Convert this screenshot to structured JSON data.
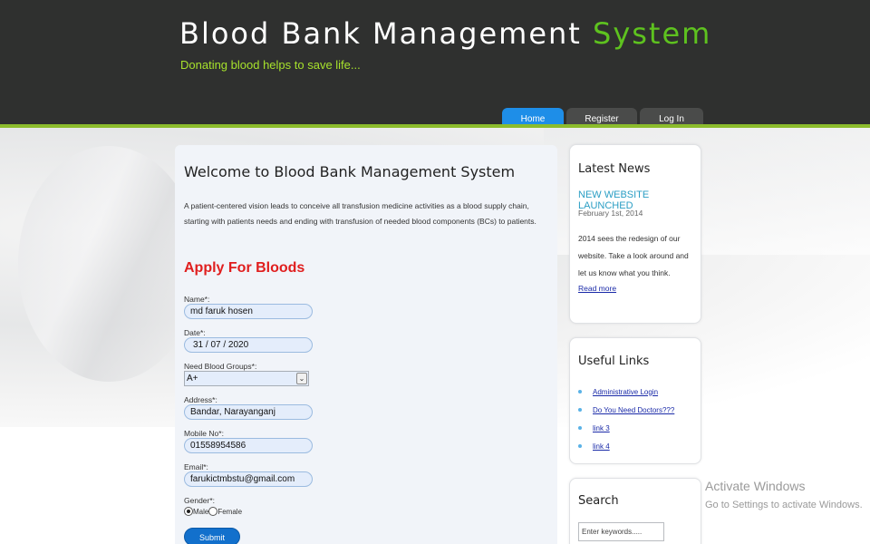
{
  "header": {
    "title_main": "Blood Bank Management ",
    "title_accent": "System",
    "tagline": "Donating blood helps to save life..."
  },
  "nav": {
    "tabs": [
      {
        "label": "Home",
        "active": true
      },
      {
        "label": "Register",
        "active": false
      },
      {
        "label": "Log In",
        "active": false
      }
    ]
  },
  "main": {
    "welcome": "Welcome to Blood Bank Management System",
    "intro": "A patient-centered vision leads to conceive all transfusion medicine activities as a blood supply chain, starting with patients needs and ending with transfusion of needed blood components (BCs) to patients.",
    "apply_title": "Apply For Bloods",
    "form": {
      "name_label": "Name*:",
      "name_value": "md faruk hosen",
      "date_label": "Date*:",
      "date_value": "31 / 07 / 2020",
      "group_label": "Need Blood Groups*:",
      "group_value": "A+",
      "address_label": "Address*:",
      "address_value": "Bandar, Narayanganj",
      "mobile_label": "Mobile No*:",
      "mobile_value": "01558954586",
      "email_label": "Email*:",
      "email_value": "farukictmbstu@gmail.com",
      "gender_label": "Gender*:",
      "gender_male": "Male",
      "gender_female": "Female",
      "gender_selected": "Male",
      "submit_label": "Submit"
    }
  },
  "sidebar": {
    "news": {
      "title": "Latest News",
      "headline": "NEW WEBSITE LAUNCHED",
      "date": "February 1st, 2014",
      "body": "2014 sees the redesign of our website. Take a look around and let us know what you think.",
      "read_more": "Read more"
    },
    "links": {
      "title": "Useful Links",
      "items": [
        "Administrative Login",
        "Do You Need Doctors???",
        "link 3",
        "link 4"
      ]
    },
    "search": {
      "title": "Search",
      "placeholder": "Enter keywords....."
    }
  },
  "watermark": {
    "title": "Activate Windows",
    "subtitle": "Go to Settings to activate Windows."
  },
  "colors": {
    "header_bg": "#2f302f",
    "accent_green": "#5ec21f",
    "nav_active": "#1e8ee8",
    "apply_red": "#e01e1e",
    "submit_blue": "#1270cc"
  }
}
